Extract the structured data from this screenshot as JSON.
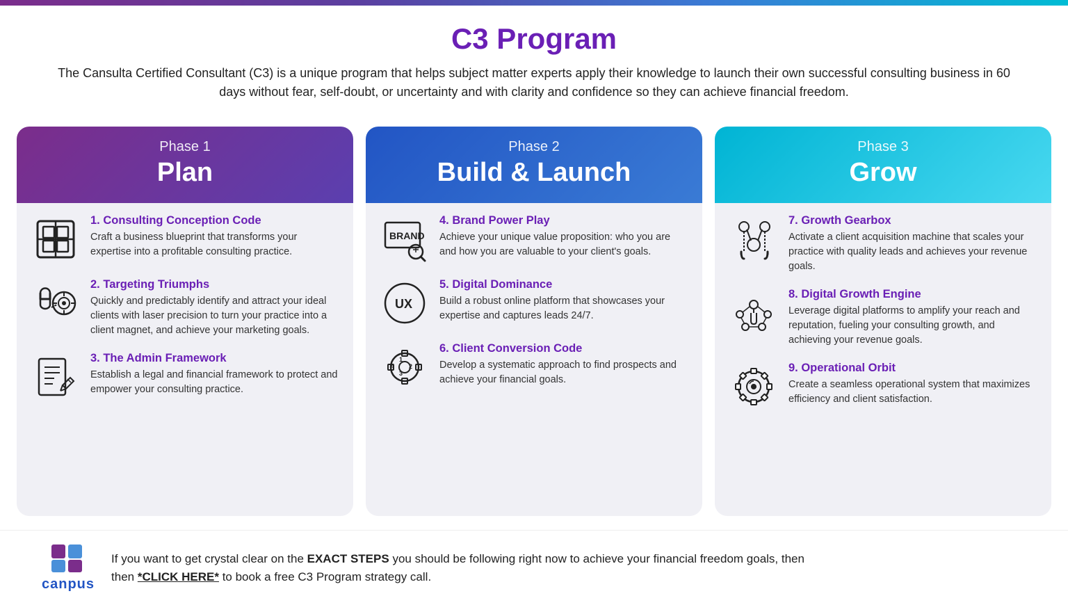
{
  "topbar": {},
  "header": {
    "title": "C3 Program",
    "description": "The Cansulta Certified Consultant (C3) is a unique program that helps subject matter experts apply their knowledge to launch their own successful consulting business in 60 days without fear, self-doubt, or uncertainty and with clarity and confidence so they can achieve financial freedom."
  },
  "phases": [
    {
      "id": "phase1",
      "num": "Phase 1",
      "name": "Plan",
      "headerClass": "phase-1-header",
      "items": [
        {
          "id": "item1",
          "title": "1. Consulting Conception Code",
          "description": "Craft a business blueprint that transforms your expertise into a profitable consulting practice.",
          "icon": "blueprint"
        },
        {
          "id": "item2",
          "title": "2. Targeting Triumphs",
          "description": "Quickly and predictably identify and attract your ideal clients with laser precision to turn your practice into a client magnet, and achieve your marketing goals.",
          "icon": "magnet-target"
        },
        {
          "id": "item3",
          "title": "3. The Admin Framework",
          "description": "Establish a legal and financial framework to protect and empower your consulting practice.",
          "icon": "doc-edit"
        }
      ]
    },
    {
      "id": "phase2",
      "num": "Phase 2",
      "name": "Build & Launch",
      "headerClass": "phase-2-header",
      "items": [
        {
          "id": "item4",
          "title": "4. Brand Power Play",
          "description": "Achieve your unique value proposition: who you are and how you are valuable to your client's goals.",
          "icon": "brand"
        },
        {
          "id": "item5",
          "title": "5. Digital Dominance",
          "description": "Build a robust online platform that showcases your expertise and captures leads 24/7.",
          "icon": "ux"
        },
        {
          "id": "item6",
          "title": "6. Client Conversion Code",
          "description": "Develop a systematic approach to find prospects and achieve your financial goals.",
          "icon": "gear-numbers"
        }
      ]
    },
    {
      "id": "phase3",
      "num": "Phase 3",
      "name": "Grow",
      "headerClass": "phase-3-header",
      "items": [
        {
          "id": "item7",
          "title": "7. Growth Gearbox",
          "description": "Activate a client acquisition machine that scales your practice with quality leads and achieves your revenue goals.",
          "icon": "magnet-people"
        },
        {
          "id": "item8",
          "title": "8. Digital Growth Engine",
          "description": "Leverage digital platforms to amplify your reach and reputation, fueling your consulting growth, and achieving your revenue goals.",
          "icon": "digital-hand"
        },
        {
          "id": "item9",
          "title": "9. Operational Orbit",
          "description": "Create a seamless operational system that maximizes efficiency and client satisfaction.",
          "icon": "gear-circle"
        }
      ]
    }
  ],
  "footer": {
    "logo_text": "canpus",
    "text_before": "If you want to get crystal clear on the ",
    "text_bold": "EXACT STEPS",
    "text_middle": " you should be following right now to achieve your financial freedom goals, then ",
    "link_text": "*CLICK HERE*",
    "text_after": " to book a free C3 Program strategy call",
    "text_end": "."
  }
}
